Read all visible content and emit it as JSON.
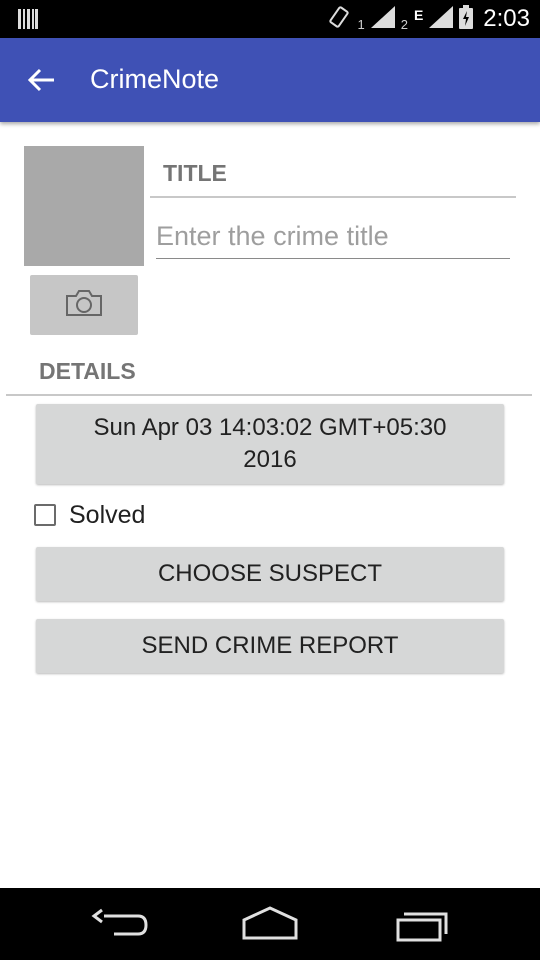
{
  "status_bar": {
    "sim1_label": "1",
    "sim2_label": "2",
    "network_type": "E",
    "time": "2:03",
    "icons": [
      "barcode-icon",
      "vibrate-icon",
      "signal-icon",
      "signal-icon",
      "battery-icon"
    ]
  },
  "app_bar": {
    "title": "CrimeNote",
    "back_icon": "arrow-left-icon"
  },
  "crime_form": {
    "title_label": "TITLE",
    "title_placeholder": "Enter the crime title",
    "title_value": "",
    "camera_icon": "camera-icon",
    "details_label": "DETAILS",
    "date_line1": "Sun Apr 03 14:03:02 GMT+05:30",
    "date_line2": "2016",
    "solved_label": "Solved",
    "solved_checked": false,
    "choose_suspect_label": "CHOOSE SUSPECT",
    "send_report_label": "SEND CRIME REPORT"
  },
  "nav_bar": {
    "icons": [
      "back-nav-icon",
      "home-nav-icon",
      "recents-nav-icon"
    ]
  },
  "colors": {
    "primary": "#3f51b5",
    "button_bg": "#d6d7d7",
    "photo_placeholder": "#a9a9a9",
    "section_label": "#757575"
  }
}
